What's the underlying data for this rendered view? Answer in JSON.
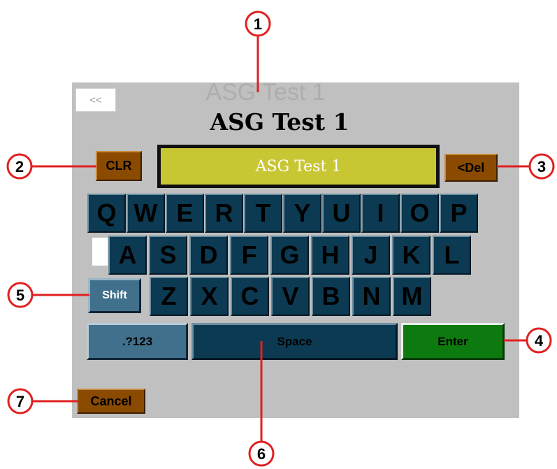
{
  "header": {
    "back_label": "<<",
    "ghost_title": "ASG Test 1",
    "title": "ASG Test 1"
  },
  "entry": {
    "value": "ASG Test 1",
    "clear_label": "CLR",
    "delete_label": "<Del"
  },
  "keyboard": {
    "row1": [
      "Q",
      "W",
      "E",
      "R",
      "T",
      "Y",
      "U",
      "I",
      "O",
      "P"
    ],
    "row2": [
      "A",
      "S",
      "D",
      "F",
      "G",
      "H",
      "J",
      "K",
      "L"
    ],
    "row3": [
      "Z",
      "X",
      "C",
      "V",
      "B",
      "N",
      "M"
    ],
    "shift_label": "Shift",
    "numbers_label": ".?123",
    "space_label": "Space",
    "enter_label": "Enter"
  },
  "cancel_label": "Cancel",
  "callouts": [
    "1",
    "2",
    "3",
    "4",
    "5",
    "6",
    "7"
  ],
  "colors": {
    "panel": "#c0c0c0",
    "key": "#0b3a52",
    "brown_button": "#8a4a00",
    "entry_field": "#c9c634",
    "enter": "#0d7a10",
    "callout": "#e02020"
  }
}
